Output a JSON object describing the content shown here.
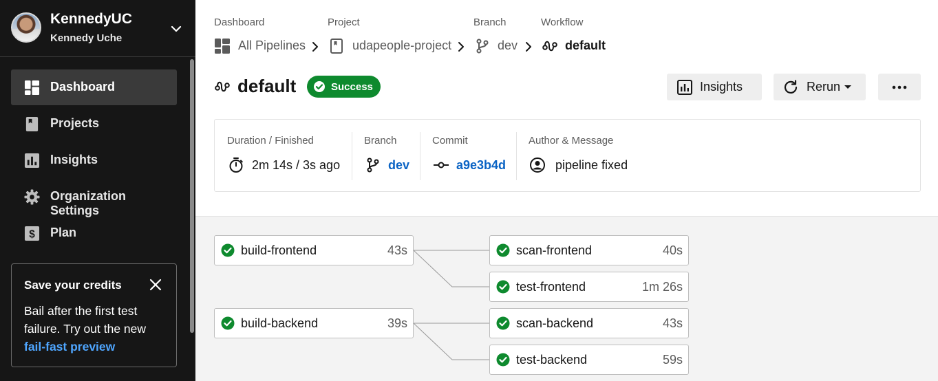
{
  "user": {
    "org_name": "KennedyUC",
    "user_name": "Kennedy Uche"
  },
  "sidebar": {
    "items": [
      {
        "label": "Dashboard",
        "icon": "dashboard-icon",
        "active": true
      },
      {
        "label": "Projects",
        "icon": "projects-icon",
        "active": false
      },
      {
        "label": "Insights",
        "icon": "insights-icon",
        "active": false
      },
      {
        "label": "Organization Settings",
        "icon": "gear-icon",
        "active": false
      },
      {
        "label": "Plan",
        "icon": "dollar-icon",
        "active": false
      }
    ],
    "promo": {
      "title": "Save your credits",
      "body": "Bail after the first test failure. Try out the new",
      "link": "fail-fast preview"
    }
  },
  "breadcrumb": {
    "labels": [
      "Dashboard",
      "Project",
      "Branch",
      "Workflow"
    ],
    "items": [
      {
        "text": "All Pipelines",
        "icon": "dashboard-icon"
      },
      {
        "text": "udapeople-project",
        "icon": "project-icon"
      },
      {
        "text": "dev",
        "icon": "branch-icon"
      },
      {
        "text": "default",
        "icon": "workflow-icon"
      }
    ]
  },
  "workflow": {
    "title": "default",
    "status": "Success"
  },
  "actions": {
    "insights": "Insights",
    "rerun": "Rerun"
  },
  "summary": {
    "duration_label": "Duration / Finished",
    "duration_value": "2m 14s / 3s ago",
    "branch_label": "Branch",
    "branch_value": "dev",
    "commit_label": "Commit",
    "commit_value": "a9e3b4d",
    "author_label": "Author & Message",
    "author_value": "pipeline fixed"
  },
  "jobs": [
    {
      "name": "build-frontend",
      "duration": "43s",
      "status": "success"
    },
    {
      "name": "scan-frontend",
      "duration": "40s",
      "status": "success"
    },
    {
      "name": "test-frontend",
      "duration": "1m 26s",
      "status": "success"
    },
    {
      "name": "build-backend",
      "duration": "39s",
      "status": "success"
    },
    {
      "name": "scan-backend",
      "duration": "43s",
      "status": "success"
    },
    {
      "name": "test-backend",
      "duration": "59s",
      "status": "success"
    }
  ],
  "colors": {
    "sidebar_bg": "#161616",
    "success": "#0e8a2e",
    "link": "#0a63c4",
    "promo_link": "#4fa6ff"
  }
}
